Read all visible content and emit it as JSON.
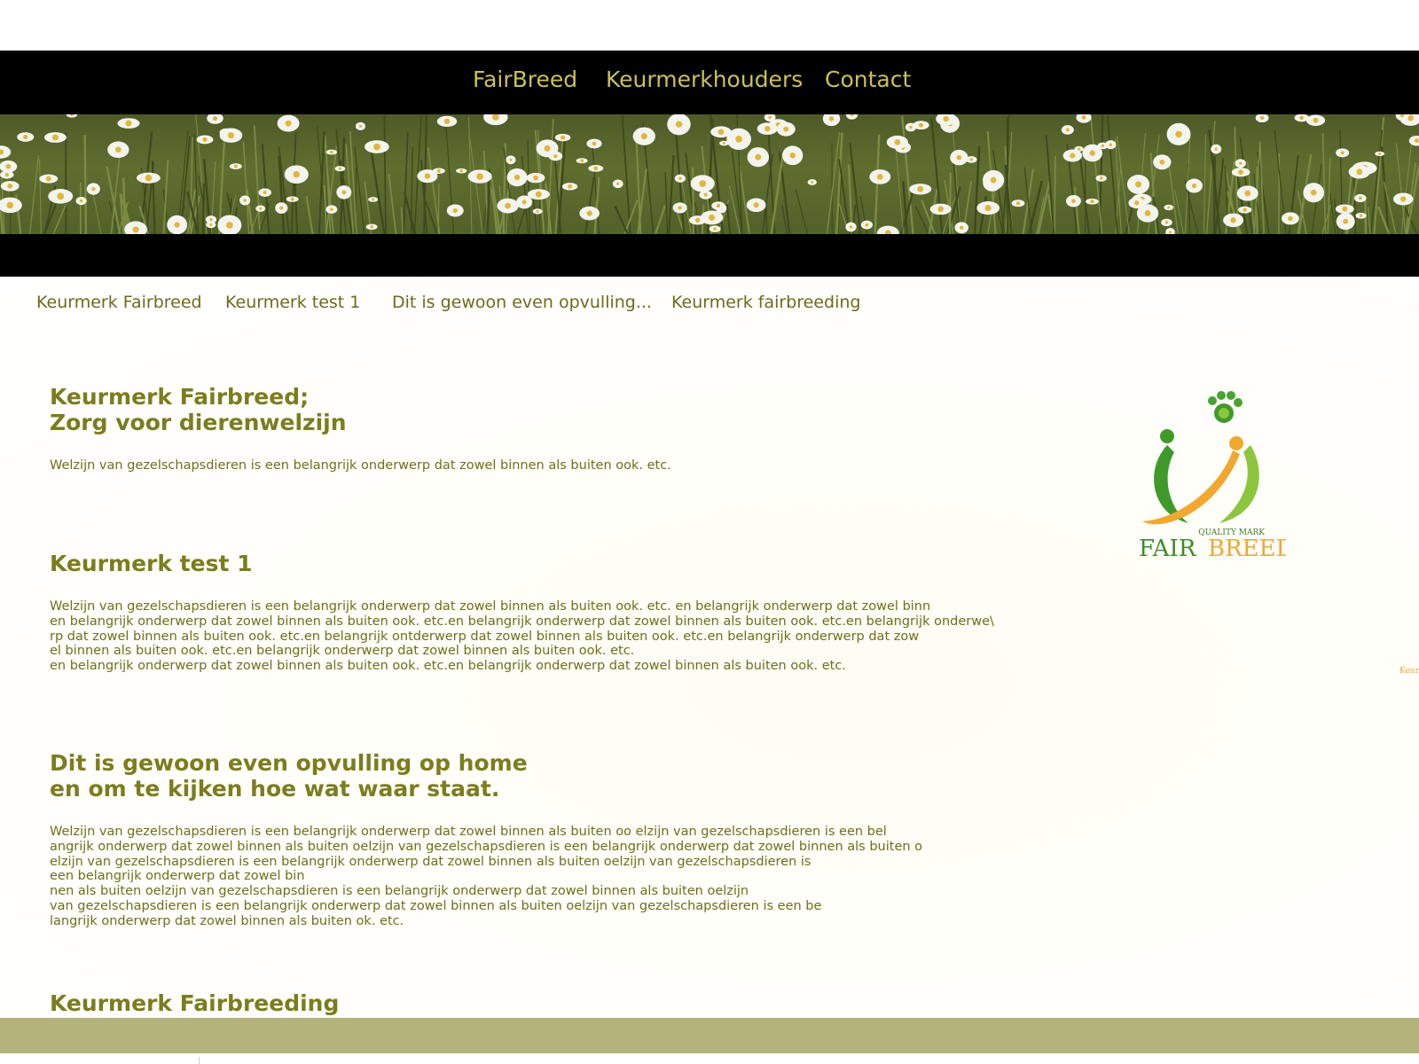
{
  "top_nav": {
    "items": [
      {
        "label": "FairBreed"
      },
      {
        "label": "Keurmerkhouders"
      },
      {
        "label": "Contact"
      }
    ]
  },
  "sub_nav": {
    "items": [
      {
        "label": "Keurmerk Fairbreed"
      },
      {
        "label": "Keurmerk test 1"
      },
      {
        "label": "Dit is gewoon even opvulling..."
      },
      {
        "label": "Keurmerk fairbreeding"
      }
    ]
  },
  "sections": [
    {
      "title": "Keurmerk Fairbreed;\nZorg voor dierenwelzijn",
      "body": "Welzijn van gezelschapsdieren is een belangrijk onderwerp dat zowel binnen als buiten ook. etc."
    },
    {
      "title": "Keurmerk test 1",
      "body": "Welzijn van gezelschapsdieren is een belangrijk onderwerp dat zowel binnen als buiten ook. etc. en belangrijk onderwerp dat zowel binn\nen belangrijk onderwerp dat zowel binnen als buiten ook. etc.en belangrijk onderwerp dat zowel binnen als buiten ook. etc.en belangrijk onderwe\\\nrp dat zowel binnen als buiten ook. etc.en belangrijk ontderwerp dat zowel binnen als buiten ook. etc.en belangrijk onderwerp dat zow\nel binnen als buiten ook. etc.en belangrijk onderwerp dat zowel binnen als buiten ook. etc.\nen belangrijk onderwerp dat zowel binnen als buiten ook. etc.en belangrijk onderwerp dat zowel binnen als buiten ook. etc."
    },
    {
      "title": "Dit is gewoon even opvulling op home\nen om te kijken hoe wat waar staat.",
      "body": "Welzijn van gezelschapsdieren is een belangrijk onderwerp dat zowel binnen als buiten oo elzijn van gezelschapsdieren is een bel\nangrijk onderwerp dat zowel binnen als buiten oelzijn van gezelschapsdieren is een belangrijk onderwerp dat zowel binnen als buiten o\nelzijn van gezelschapsdieren is een belangrijk onderwerp dat zowel binnen als buiten oelzijn van gezelschapsdieren is\n een belangrijk onderwerp dat zowel bin\nnen als buiten oelzijn van gezelschapsdieren is een belangrijk onderwerp dat zowel binnen als buiten oelzijn\n van gezelschapsdieren is een belangrijk onderwerp dat zowel binnen als buiten oelzijn van gezelschapsdieren is een be\nlangrijk onderwerp dat zowel binnen als buiten ok. etc."
    },
    {
      "title": "Keurmerk Fairbreeding"
    }
  ],
  "logo": {
    "quality_mark": "QUALITY MARK",
    "brand_fair": "FAIR",
    "brand_breed": "BREED"
  },
  "edge_text": "Keur",
  "colors": {
    "nav_text": "#c9c15a",
    "heading": "#7b7d1f",
    "body_text": "#6d6f1c",
    "footer": "#b3b37c",
    "logo_green": "#3f9a2a",
    "logo_orange": "#f0a830"
  }
}
